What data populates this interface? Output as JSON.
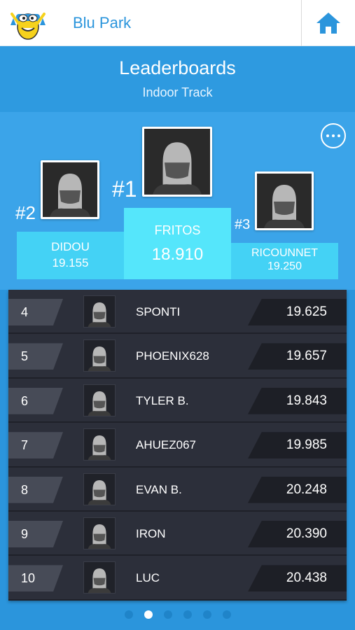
{
  "app": {
    "title": "Blu Park",
    "logo_icon": "mascot-logo-icon",
    "home_icon": "home-icon"
  },
  "header": {
    "title": "Leaderboards",
    "subtitle": "Indoor Track"
  },
  "podium": [
    {
      "rank_label": "#1",
      "name": "FRITOS",
      "time": "18.910"
    },
    {
      "rank_label": "#2",
      "name": "DIDOU",
      "time": "19.155"
    },
    {
      "rank_label": "#3",
      "name": "RICOUNNET",
      "time": "19.250"
    }
  ],
  "leaderboard": [
    {
      "rank": "4",
      "name": "SPONTI",
      "time": "19.625"
    },
    {
      "rank": "5",
      "name": "PHOENIX628",
      "time": "19.657"
    },
    {
      "rank": "6",
      "name": "TYLER B.",
      "time": "19.843"
    },
    {
      "rank": "7",
      "name": "AHUEZ067",
      "time": "19.985"
    },
    {
      "rank": "8",
      "name": "EVAN B.",
      "time": "20.248"
    },
    {
      "rank": "9",
      "name": "IRON",
      "time": "20.390"
    },
    {
      "rank": "10",
      "name": "LUC",
      "time": "20.438"
    }
  ],
  "pagination": {
    "total": 6,
    "active_index": 1
  },
  "colors": {
    "primary": "#2b95dc",
    "plinth_first": "#55e6fb",
    "plinth_other": "#44d2f5",
    "board": "#2c2f3a"
  }
}
